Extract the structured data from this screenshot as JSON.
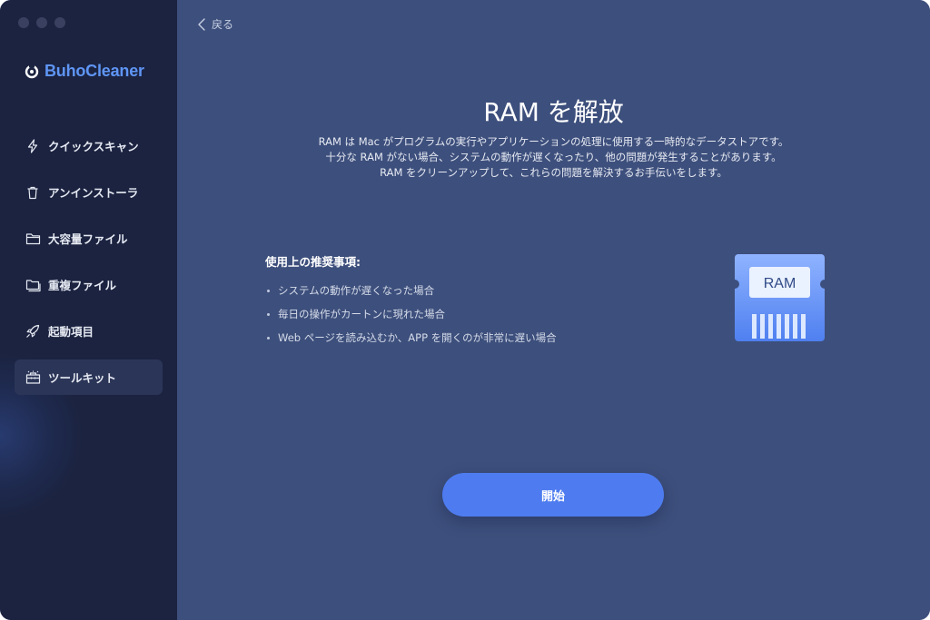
{
  "app": {
    "brand_name": "BuhoCleaner",
    "brand_color": "#5f95f5"
  },
  "sidebar": {
    "items": [
      {
        "label": "クイックスキャン",
        "icon": "lightning-icon",
        "active": false
      },
      {
        "label": "アンインストーラ",
        "icon": "trash-icon",
        "active": false
      },
      {
        "label": "大容量ファイル",
        "icon": "folder-icon",
        "active": false
      },
      {
        "label": "重複ファイル",
        "icon": "duplicate-folder-icon",
        "active": false
      },
      {
        "label": "起動項目",
        "icon": "rocket-icon",
        "active": false
      },
      {
        "label": "ツールキット",
        "icon": "toolkit-icon",
        "active": true
      }
    ]
  },
  "header": {
    "back_label": "戻る"
  },
  "main": {
    "title": "RAM を解放",
    "description": [
      "RAM は Mac がプログラムの実行やアプリケーションの処理に使用する一時的なデータストアです。",
      "十分な RAM がない場合、システムの動作が遅くなったり、他の問題が発生することがあります。",
      "RAM をクリーンアップして、これらの問題を解決するお手伝いをします。"
    ],
    "recommend_title": "使用上の推奨事項:",
    "recommendations": [
      "システムの動作が遅くなった場合",
      "毎日の操作がカートンに現れた場合",
      "Web ページを読み込むか、APP を開くのが非常に遅い場合"
    ],
    "illustration_label": "RAM",
    "start_label": "開始"
  },
  "colors": {
    "sidebar_bg": "#1b2340",
    "main_bg": "#3d4f7c",
    "accent": "#4e7cf0"
  }
}
